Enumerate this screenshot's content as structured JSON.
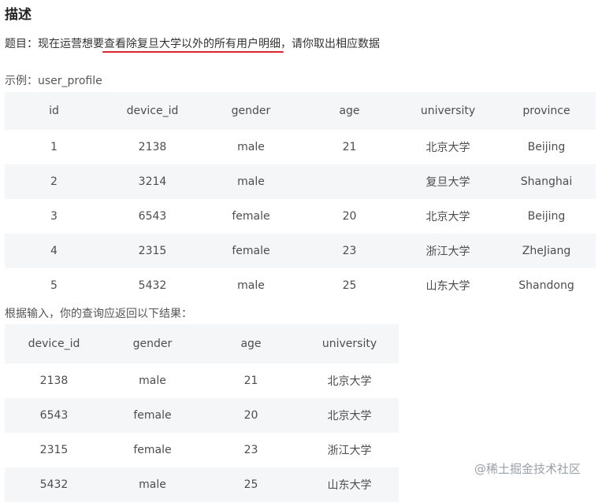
{
  "heading": "描述",
  "question": {
    "prefix": "题目：现在运营想要",
    "highlight": "查看除复旦大学以外的所有用户明细",
    "suffix": "，请你取出相应数据"
  },
  "example_label": "示例：user_profile",
  "input_table": {
    "headers": [
      "id",
      "device_id",
      "gender",
      "age",
      "university",
      "province"
    ],
    "rows": [
      [
        "1",
        "2138",
        "male",
        "21",
        "北京大学",
        "Beijing"
      ],
      [
        "2",
        "3214",
        "male",
        "",
        "复旦大学",
        "Shanghai"
      ],
      [
        "3",
        "6543",
        "female",
        "20",
        "北京大学",
        "Beijing"
      ],
      [
        "4",
        "2315",
        "female",
        "23",
        "浙江大学",
        "ZheJiang"
      ],
      [
        "5",
        "5432",
        "male",
        "25",
        "山东大学",
        "Shandong"
      ]
    ]
  },
  "result_label": "根据输入，你的查询应返回以下结果：",
  "result_table": {
    "headers": [
      "device_id",
      "gender",
      "age",
      "university"
    ],
    "rows": [
      [
        "2138",
        "male",
        "21",
        "北京大学"
      ],
      [
        "6543",
        "female",
        "20",
        "北京大学"
      ],
      [
        "2315",
        "female",
        "23",
        "浙江大学"
      ],
      [
        "5432",
        "male",
        "25",
        "山东大学"
      ]
    ]
  },
  "watermark": "@稀土掘金技术社区",
  "colors": {
    "underline": "#d9262e",
    "row_shade": "#f5f6f7"
  }
}
